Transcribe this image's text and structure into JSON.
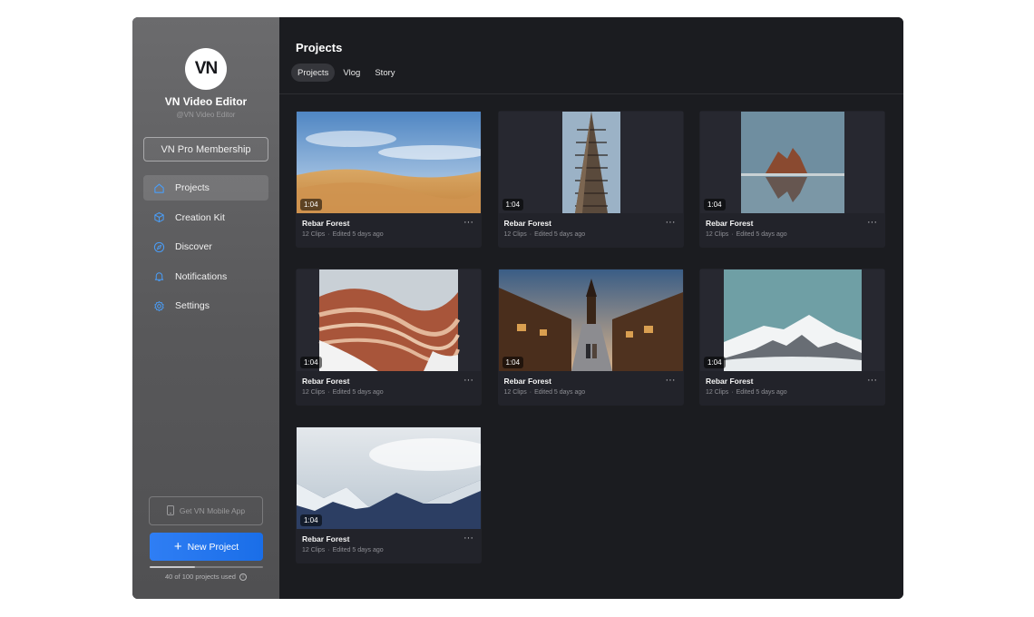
{
  "sidebar": {
    "logo_text": "VN",
    "app_name": "VN Video Editor",
    "app_handle": "@VN Video Editor",
    "membership_label": "VN Pro Membership",
    "items": [
      {
        "label": "Projects",
        "icon": "home-icon",
        "active": true
      },
      {
        "label": "Creation Kit",
        "icon": "cube-icon",
        "active": false
      },
      {
        "label": "Discover",
        "icon": "compass-icon",
        "active": false
      },
      {
        "label": "Notifications",
        "icon": "bell-icon",
        "active": false
      },
      {
        "label": "Settings",
        "icon": "gear-icon",
        "active": false
      }
    ],
    "get_app_label": "Get VN Mobile App",
    "new_project_label": "New Project",
    "usage_fraction": 0.4,
    "usage_text": "40 of 100 projects used"
  },
  "main": {
    "title": "Projects",
    "tabs": [
      {
        "label": "Projects",
        "active": true
      },
      {
        "label": "Vlog",
        "active": false
      },
      {
        "label": "Story",
        "active": false
      }
    ],
    "projects": [
      {
        "title": "Rebar Forest",
        "clips": "12 Clips",
        "edited": "Edited 5 days ago",
        "duration": "1:04",
        "thumb": "desert"
      },
      {
        "title": "Rebar Forest",
        "clips": "12 Clips",
        "edited": "Edited 5 days ago",
        "duration": "1:04",
        "thumb": "tower"
      },
      {
        "title": "Rebar Forest",
        "clips": "12 Clips",
        "edited": "Edited 5 days ago",
        "duration": "1:04",
        "thumb": "sea-rock"
      },
      {
        "title": "Rebar Forest",
        "clips": "12 Clips",
        "edited": "Edited 5 days ago",
        "duration": "1:04",
        "thumb": "canyon"
      },
      {
        "title": "Rebar Forest",
        "clips": "12 Clips",
        "edited": "Edited 5 days ago",
        "duration": "1:04",
        "thumb": "street"
      },
      {
        "title": "Rebar Forest",
        "clips": "12 Clips",
        "edited": "Edited 5 days ago",
        "duration": "1:04",
        "thumb": "mountain"
      },
      {
        "title": "Rebar Forest",
        "clips": "12 Clips",
        "edited": "Edited 5 days ago",
        "duration": "1:04",
        "thumb": "alps"
      }
    ]
  },
  "colors": {
    "accent": "#1f72ee",
    "sidebar": "#5f5f61",
    "background": "#1b1c20"
  }
}
